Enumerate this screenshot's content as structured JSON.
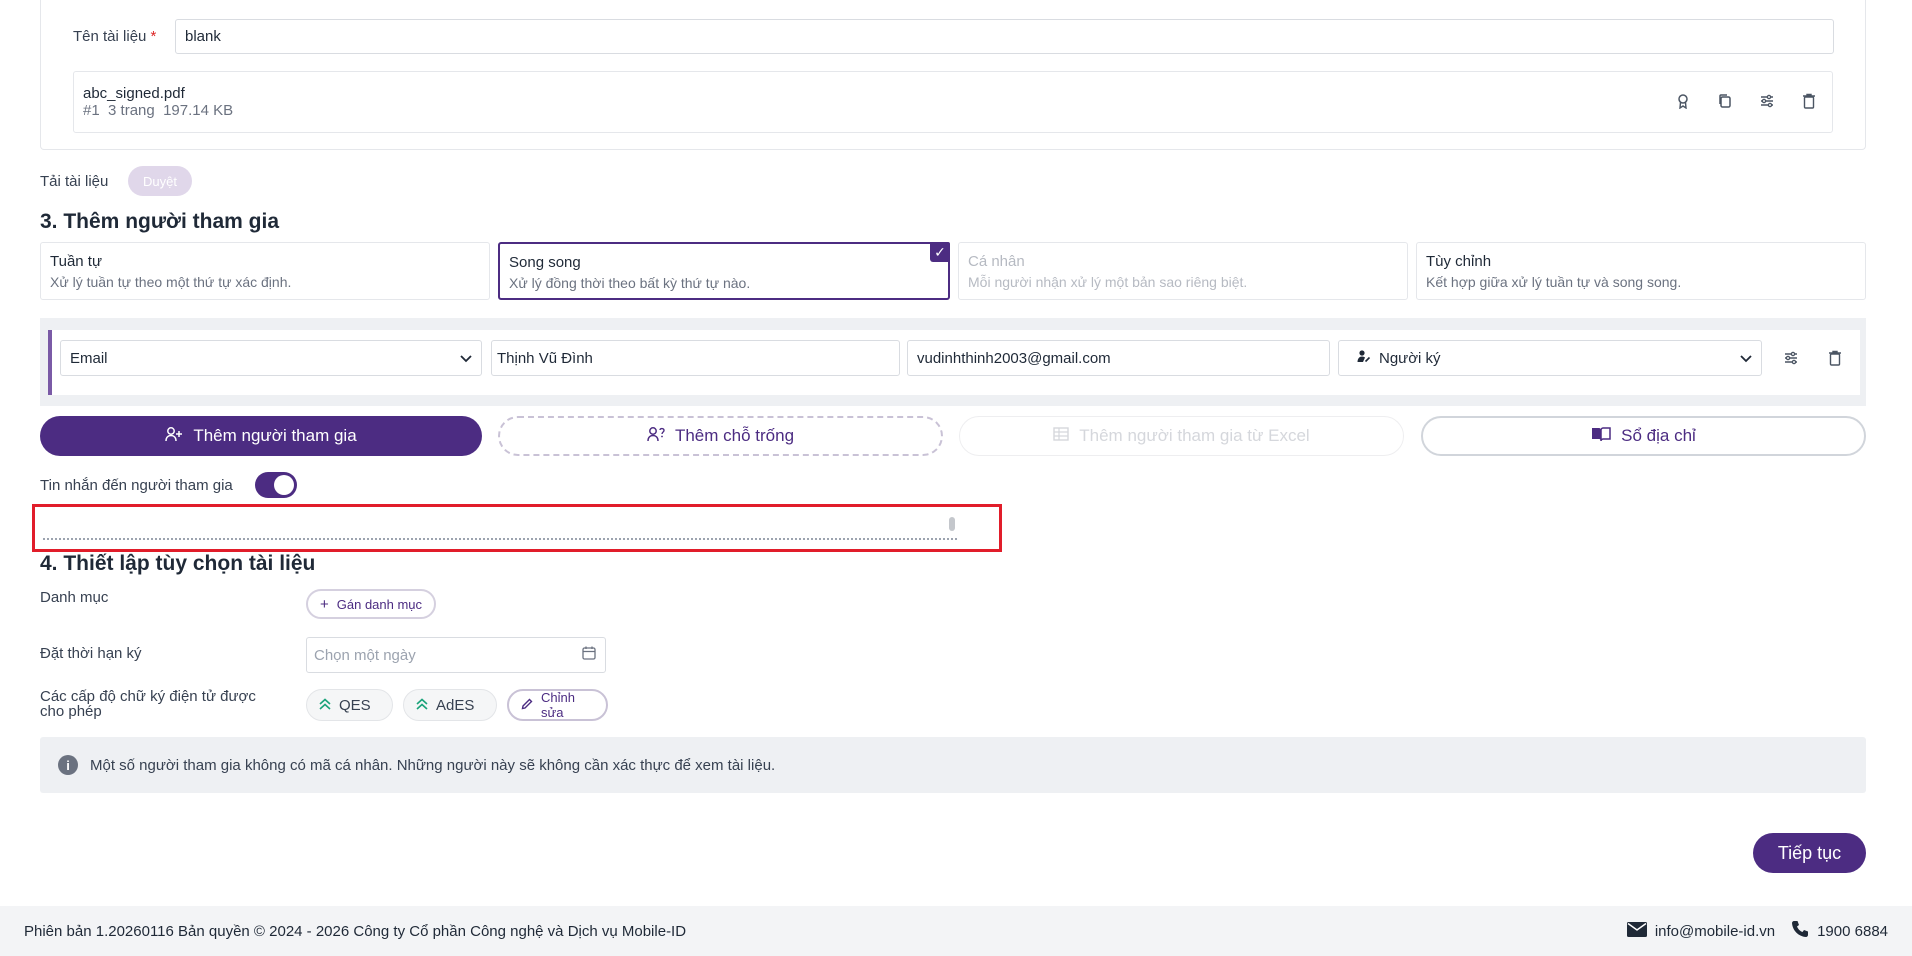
{
  "doc": {
    "name_label": "Tên tài liệu",
    "required_mark": "*",
    "name_value": "blank",
    "file_name": "abc_signed.pdf",
    "file_index": "#1",
    "file_pages": "3 trang",
    "file_size": "197.14 KB",
    "upload_label": "Tải tài liệu",
    "approve_label": "Duyệt"
  },
  "section3": {
    "title": "3. Thêm người tham gia",
    "options": [
      {
        "title": "Tuần tự",
        "desc": "Xử lý tuần tự theo một thứ tự xác định."
      },
      {
        "title": "Song song",
        "desc": "Xử lý đồng thời theo bất kỳ thứ tự nào."
      },
      {
        "title": "Cá nhân",
        "desc": "Mỗi người nhận xử lý một bản sao riêng biệt."
      },
      {
        "title": "Tùy chỉnh",
        "desc": "Kết hợp giữa xử lý tuần tự và song song."
      }
    ],
    "selected_option": "Song song",
    "participant": {
      "method": "Email",
      "name": "Thịnh Vũ Đình",
      "email": "vudinhthinh2003@gmail.com",
      "role": "Người ký"
    },
    "buttons": {
      "add_participant": "Thêm người tham gia",
      "add_placeholder": "Thêm chỗ trống",
      "add_from_excel": "Thêm người tham gia từ Excel",
      "address_book": "Sổ địa chỉ"
    },
    "message_label": "Tin nhắn đến người tham gia",
    "message_enabled": true,
    "message_value": ""
  },
  "section4": {
    "title": "4. Thiết lập tùy chọn tài liệu",
    "category_label": "Danh mục",
    "category_button": "Gán danh mục",
    "deadline_label": "Đặt thời hạn ký",
    "deadline_placeholder": "Chọn một ngày",
    "levels_label_1": "Các cấp độ chữ ký điện tử được",
    "levels_label_2": "cho phép",
    "levels": [
      "QES",
      "AdES"
    ],
    "edit_button": "Chỉnh sửa"
  },
  "info_text": "Một số người tham gia không có mã cá nhân. Những người này sẽ không cần xác thực để xem tài liệu.",
  "next_button": "Tiếp tục",
  "footer": {
    "version": "Phiên bản 1.20260116 Bản quyền © 2024 - 2026 Công ty Cổ phần Công nghệ và Dịch vụ Mobile-ID",
    "email": "info@mobile-id.vn",
    "phone": "1900 6884"
  },
  "colors": {
    "primary": "#4c2c82",
    "highlight": "#e11d2a",
    "success": "#1aa37a"
  }
}
